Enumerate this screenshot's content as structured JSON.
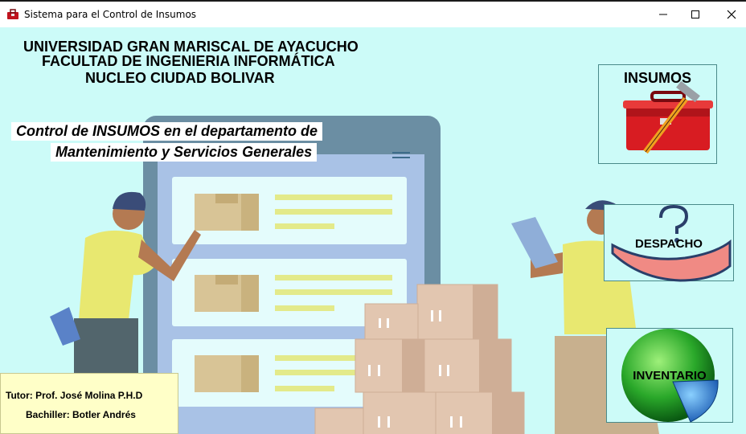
{
  "window": {
    "title": "Sistema para el Control de Insumos"
  },
  "header": {
    "line1": "UNIVERSIDAD GRAN MARISCAL DE AYACUCHO",
    "line2": "FACULTAD DE INGENIERIA INFORMÁTICA",
    "line3": "NUCLEO CIUDAD BOLIVAR"
  },
  "subtitle": {
    "line1": "Control de INSUMOS en el departamento de",
    "line2": "Mantenimiento y Servicios Generales"
  },
  "menu": {
    "insumos_label": "INSUMOS",
    "despacho_label": "DESPACHO",
    "inventario_label": "INVENTARIO"
  },
  "credits": {
    "tutor": "Tutor: Prof. José Molina P.H.D",
    "bachiller": "Bachiller: Botler Andrés"
  },
  "colors": {
    "background": "#ccfbf8",
    "credits_background": "#ffffc8"
  }
}
